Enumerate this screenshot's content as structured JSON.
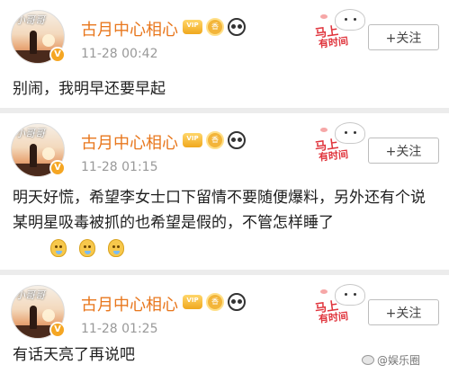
{
  "posts": [
    {
      "avatar_tag": "小哥哥",
      "username": "古月中心相心",
      "time": "11-28 00:42",
      "follow_label": "+关注",
      "sticker_text_1": "马上",
      "sticker_text_2": "有时间",
      "content": "别闹，我明早还要早起"
    },
    {
      "avatar_tag": "小哥哥",
      "username": "古月中心相心",
      "time": "11-28 01:15",
      "follow_label": "+关注",
      "sticker_text_1": "马上",
      "sticker_text_2": "有时间",
      "content": "明天好慌，希望李女士口下留情不要随便爆料，另外还有个说某明星吸毒被抓的也希望是假的，不管怎样睡了"
    },
    {
      "avatar_tag": "小哥哥",
      "username": "古月中心相心",
      "time": "11-28 01:25",
      "follow_label": "+关注",
      "sticker_text_1": "马上",
      "sticker_text_2": "有时间",
      "content": "有话天亮了再说吧"
    }
  ],
  "badges": {
    "vip_text": "VIP",
    "medal_text": "香"
  },
  "watermark": "@娱乐圈",
  "colors": {
    "username": "#e8771d",
    "time": "#999999",
    "background": "#ececec"
  },
  "icons": [
    "vip-badge-icon",
    "medal-badge-icon",
    "panda-badge-icon",
    "sweat-emoji-icon",
    "weibo-logo-icon"
  ]
}
